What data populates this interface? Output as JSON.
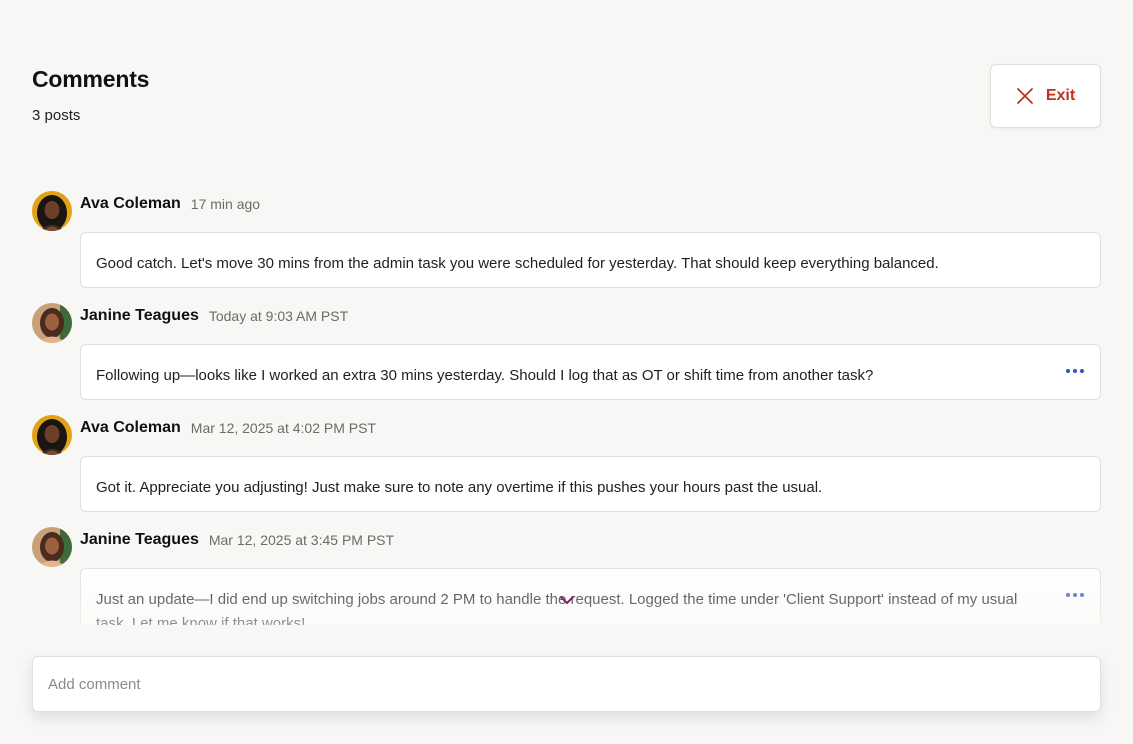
{
  "header": {
    "title": "Comments",
    "post_count": "3 posts",
    "exit_label": "Exit"
  },
  "posts": [
    {
      "author": "Ava Coleman",
      "time": "17 min ago",
      "body": "Good catch. Let's move 30 mins from the admin task you were scheduled for yesterday. That should keep everything balanced.",
      "has_menu": false
    },
    {
      "author": "Janine Teagues",
      "time": "Today at 9:03 AM PST",
      "body": "Following up—looks like I worked an extra 30 mins yesterday. Should I log that as OT or shift time from another task?",
      "has_menu": true
    },
    {
      "author": "Ava Coleman",
      "time": "Mar 12, 2025 at 4:02 PM PST",
      "body": "Got it. Appreciate you adjusting! Just make sure to note any overtime if this pushes your hours past the usual.",
      "has_menu": false
    },
    {
      "author": "Janine Teagues",
      "time": "Mar 12, 2025 at 3:45 PM PST",
      "body": "Just an update—I did end up switching jobs around 2 PM to handle the request. Logged the time under 'Client Support' instead of my usual task. Let me know if that works!",
      "has_menu": true
    }
  ],
  "composer": {
    "placeholder": "Add comment"
  },
  "icons": {
    "exit": "close-icon",
    "more": "more-horizontal-icon",
    "scroll": "chevron-down-icon"
  },
  "colors": {
    "accent_red": "#c0321e",
    "menu_blue": "#2f56c9",
    "chevron_purple": "#8a1a6a",
    "background": "#f8f7f5"
  }
}
